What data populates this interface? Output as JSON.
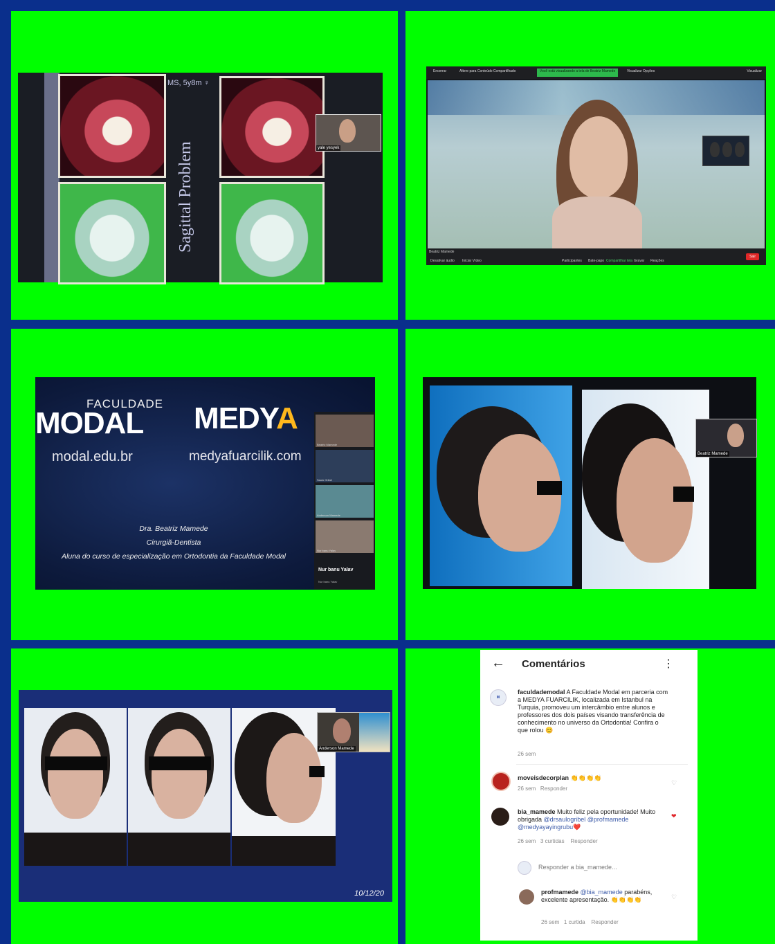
{
  "panel1": {
    "case_label": "MS, 5y8m ♀",
    "vertical_title": "Sagittal Problem",
    "pip_name": "yale yesyek"
  },
  "panel2": {
    "topbar_items": [
      "Encerrar",
      "Altere para Conteúdo Compartilhado"
    ],
    "share_banner": "Você está visualizando a tela de Beatriz Mamede",
    "view_options": "Visualizar Opções",
    "view_right": "Visualizar",
    "bottom_left": "Beatriz Mamede",
    "bottom_items": [
      "Desativar áudio",
      "Iniciar Vídeo",
      "Participantes",
      "Bate-papo",
      "Compartilhar tela",
      "Gravar",
      "Reações"
    ],
    "end_label": "Sair"
  },
  "panel3": {
    "faculdade": "FACULDADE",
    "modal": "MODAL",
    "medya": "MEDY",
    "medya_a": "A",
    "url_modal": "modal.edu.br",
    "url_medya": "medyafuarcilik.com",
    "speaker_name": "Dra. Beatriz Mamede",
    "speaker_role": "Cirurgiã-Dentista",
    "speaker_desc": "Aluna do curso de especialização em Ortodontia da Faculdade Modal",
    "tiles": [
      "Beatriz Mamede",
      "Saulo Gribel",
      "Anderson Mamede",
      "Nur banu Yalav"
    ],
    "nur_label": "Nur banu Yalav",
    "nur_sub": "Nur banu Yalav"
  },
  "panel4": {
    "pip_name": "Beatriz Mamede"
  },
  "panel5": {
    "date": "10/12/20",
    "pip_name": "Anderson Mamede"
  },
  "panel6": {
    "header_title": "Comentários",
    "caption_user": "faculdademodal",
    "caption_text": "A Faculdade Modal em parceria com a MEDYA FUARCILIK, localizada em Istanbul na Turquia, promoveu um intercâmbio entre alunos e professores dos dois países visando transferência de conhecimento no universo da Ortodontia! Confira o que rolou 😊",
    "caption_time": "26 sem",
    "comments": [
      {
        "user": "moveisdecorplan",
        "text": "👏👏👏👏",
        "time": "26 sem",
        "reply": "Responder"
      },
      {
        "user": "bia_mamede",
        "text": "Muito feliz pela oportunidade! Muito obrigada",
        "mention1": "@drsaulogribel",
        "mention2": "@profmamede",
        "mention3": "@medyayayingrubu",
        "emoji": "❤️",
        "time": "26 sem",
        "likes": "3 curtidas",
        "reply": "Responder"
      },
      {
        "user": "profmamede",
        "mention": "@bia_mamede",
        "text": "parabéns, excelente apresentação.",
        "emoji": "👏👏👏👏",
        "time": "26 sem",
        "likes": "1 curtida",
        "reply": "Responder"
      }
    ],
    "reply_placeholder": "Responder a bia_mamede..."
  }
}
